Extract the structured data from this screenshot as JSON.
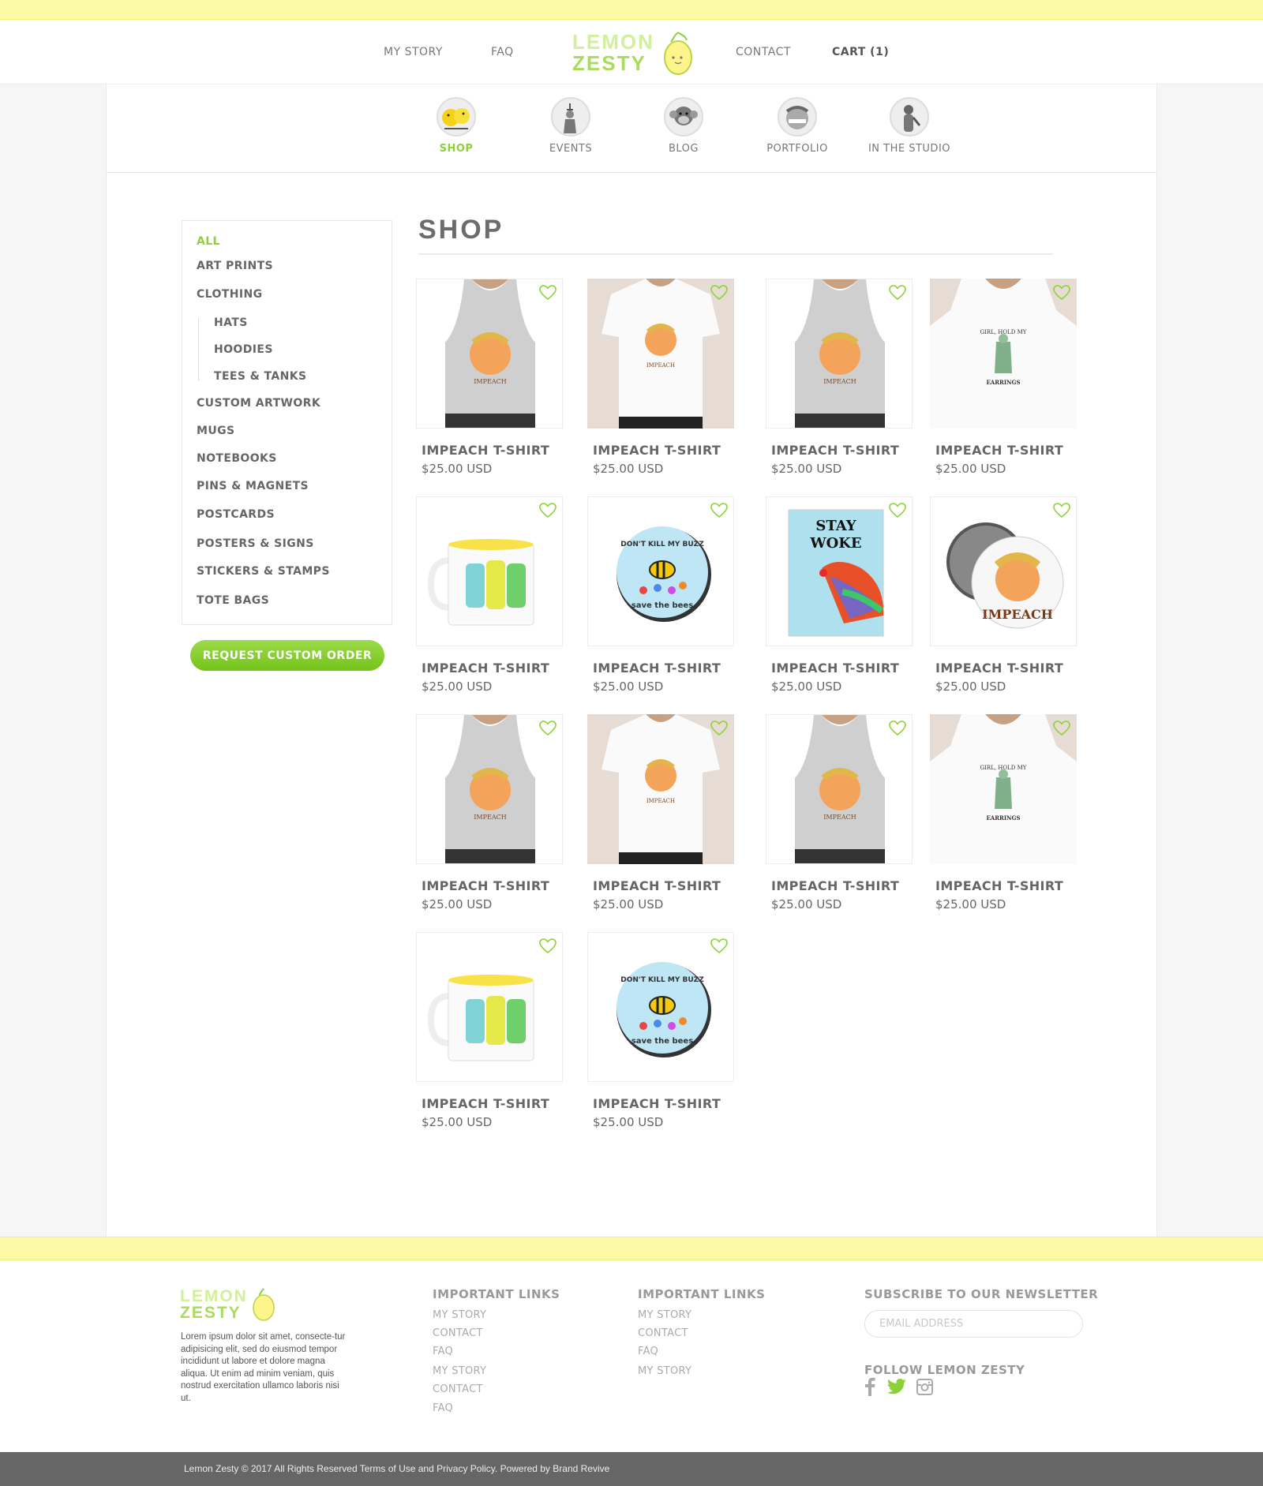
{
  "header": {
    "nav": [
      "MY STORY",
      "FAQ",
      "CONTACT",
      "CART (1)"
    ],
    "logo_line1": "LEMON",
    "logo_line2": "ZESTY"
  },
  "categories": [
    {
      "label": "SHOP",
      "active": true,
      "icon": "chicks-icon"
    },
    {
      "label": "EVENTS",
      "active": false,
      "icon": "statue-of-liberty-icon"
    },
    {
      "label": "BLOG",
      "active": false,
      "icon": "monkey-icon"
    },
    {
      "label": "PORTFOLIO",
      "active": false,
      "icon": "impeach-peach-icon"
    },
    {
      "label": "IN THE STUDIO",
      "active": false,
      "icon": "sloth-icon"
    }
  ],
  "sidebar": {
    "items": [
      {
        "label": "ALL",
        "active": true,
        "sub": false
      },
      {
        "label": "ART PRINTS",
        "sub": false
      },
      {
        "label": "CLOTHING",
        "sub": false
      },
      {
        "label": "HATS",
        "sub": true
      },
      {
        "label": "HOODIES",
        "sub": true
      },
      {
        "label": "TEES & TANKS",
        "sub": true
      },
      {
        "label": "CUSTOM ARTWORK",
        "sub": false
      },
      {
        "label": "MUGS",
        "sub": false
      },
      {
        "label": "NOTEBOOKS",
        "sub": false
      },
      {
        "label": "PINS & MAGNETS",
        "sub": false
      },
      {
        "label": "POSTCARDS",
        "sub": false
      },
      {
        "label": "POSTERS & SIGNS",
        "sub": false
      },
      {
        "label": "STICKERS & STAMPS",
        "sub": false
      },
      {
        "label": "TOTE BAGS",
        "sub": false
      }
    ],
    "button_label": "REQUEST CUSTOM ORDER"
  },
  "shop": {
    "title": "SHOP",
    "products": [
      {
        "name": "IMPEACH T-SHIRT",
        "price": "$25.00 USD",
        "kind": "tank"
      },
      {
        "name": "IMPEACH T-SHIRT",
        "price": "$25.00 USD",
        "kind": "tee"
      },
      {
        "name": "IMPEACH T-SHIRT",
        "price": "$25.00 USD",
        "kind": "tank"
      },
      {
        "name": "IMPEACH T-SHIRT",
        "price": "$25.00 USD",
        "kind": "liberty-tee",
        "print_top": "GIRL, HOLD MY",
        "print_bottom": "EARRINGS"
      },
      {
        "name": "IMPEACH T-SHIRT",
        "price": "$25.00 USD",
        "kind": "mug"
      },
      {
        "name": "IMPEACH T-SHIRT",
        "price": "$25.00 USD",
        "kind": "bee-button",
        "print_top": "DON'T KILL MY BUZZ",
        "print_bottom": "save the bees"
      },
      {
        "name": "IMPEACH T-SHIRT",
        "price": "$25.00 USD",
        "kind": "rooster",
        "print_top": "STAY",
        "print_bottom": "WOKE"
      },
      {
        "name": "IMPEACH T-SHIRT",
        "price": "$25.00 USD",
        "kind": "pin",
        "print_bottom": "IMPEACH"
      },
      {
        "name": "IMPEACH T-SHIRT",
        "price": "$25.00 USD",
        "kind": "tank"
      },
      {
        "name": "IMPEACH T-SHIRT",
        "price": "$25.00 USD",
        "kind": "tee"
      },
      {
        "name": "IMPEACH T-SHIRT",
        "price": "$25.00 USD",
        "kind": "tank"
      },
      {
        "name": "IMPEACH T-SHIRT",
        "price": "$25.00 USD",
        "kind": "liberty-tee",
        "print_top": "GIRL, HOLD MY",
        "print_bottom": "EARRINGS"
      },
      {
        "name": "IMPEACH T-SHIRT",
        "price": "$25.00 USD",
        "kind": "mug"
      },
      {
        "name": "IMPEACH T-SHIRT",
        "price": "$25.00 USD",
        "kind": "bee-button",
        "print_top": "DON'T KILL MY BUZZ",
        "print_bottom": "save the bees"
      }
    ],
    "shirt_print": "IMPEACH"
  },
  "footer": {
    "logo_line1": "LEMON",
    "logo_line2": "ZESTY",
    "about": "Lorem ipsum dolor sit amet, consecte-tur adipisicing elit, sed do eiusmod tempor incididunt ut labore et dolore magna aliqua. Ut enim ad minim veniam, quis nostrud exercitation ullamco laboris nisi ut.",
    "col1_head": "IMPORTANT LINKS",
    "col1_links": [
      "MY STORY",
      "CONTACT",
      "FAQ",
      "MY STORY",
      "CONTACT",
      "FAQ"
    ],
    "col2_head": "IMPORTANT LINKS",
    "col2_links": [
      "MY STORY",
      "CONTACT",
      "FAQ",
      "MY STORY"
    ],
    "newsletter_head": "SUBSCRIBE TO OUR NEWSLETTER",
    "email_placeholder": "EMAIL ADDRESS",
    "follow_head": "FOLLOW LEMON ZESTY",
    "social": [
      "facebook-icon",
      "twitter-icon",
      "instagram-icon"
    ],
    "copyright": "Lemon Zesty © 2017 All Rights Reserved Terms of Use and Privacy Policy. Powered by Brand Revive"
  },
  "colors": {
    "accent_green": "#8cd13a",
    "band_yellow": "#fbf9a4",
    "heart": "#8cd13a"
  }
}
